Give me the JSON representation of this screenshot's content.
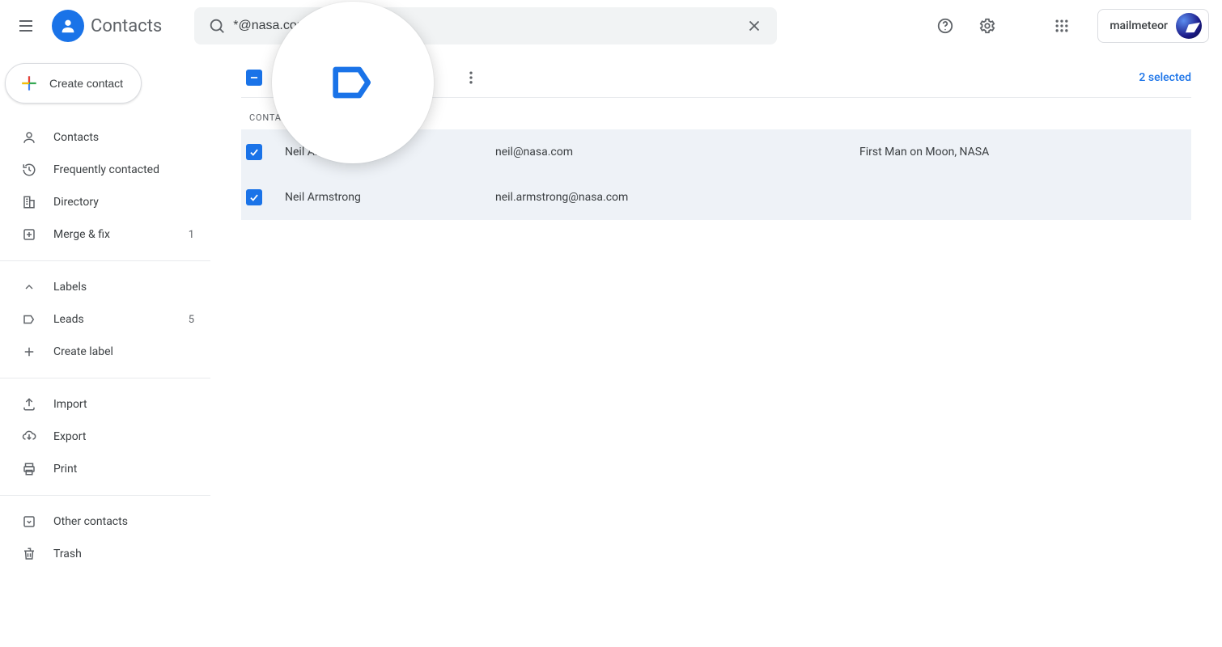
{
  "app": {
    "title": "Contacts"
  },
  "search": {
    "value": "*@nasa.com"
  },
  "account": {
    "label": "mailmeteor"
  },
  "sidebar": {
    "create": "Create contact",
    "nav1": [
      {
        "label": "Contacts",
        "count": ""
      },
      {
        "label": "Frequently contacted",
        "count": ""
      },
      {
        "label": "Directory",
        "count": ""
      },
      {
        "label": "Merge & fix",
        "count": "1"
      }
    ],
    "labels_header": "Labels",
    "labels": [
      {
        "label": "Leads",
        "count": "5"
      }
    ],
    "create_label": "Create label",
    "io": [
      {
        "label": "Import"
      },
      {
        "label": "Export"
      },
      {
        "label": "Print"
      }
    ],
    "misc": [
      {
        "label": "Other contacts"
      },
      {
        "label": "Trash"
      }
    ]
  },
  "main": {
    "selected_text": "2 selected",
    "section": "CONTACTS",
    "rows": [
      {
        "name": "Neil Armstrong",
        "email": "neil@nasa.com",
        "notes": "First Man on Moon, NASA"
      },
      {
        "name": "Neil Armstrong",
        "email": "neil.armstrong@nasa.com",
        "notes": ""
      }
    ]
  }
}
